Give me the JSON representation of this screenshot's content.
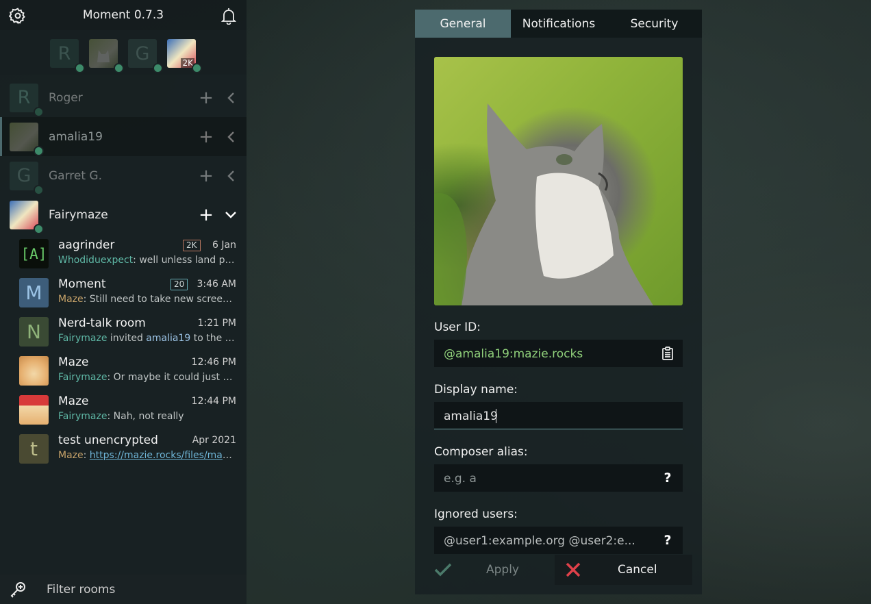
{
  "app": {
    "title": "Moment 0.7.3"
  },
  "colors": {
    "accent": "#4c6a6e",
    "presence": "#3d8b6a",
    "user_id": "#8fcf7a",
    "sender": "#5fb8a6",
    "cancel_x": "#e0414a"
  },
  "account_avatars": [
    {
      "letter": "R",
      "icon": "letter-avatar"
    },
    {
      "letter": "",
      "icon": "cat-avatar"
    },
    {
      "letter": "G",
      "icon": "letter-avatar"
    },
    {
      "letter": "",
      "icon": "anime-avatar",
      "badge": "2K"
    }
  ],
  "accounts": [
    {
      "name": "Roger",
      "letter": "R"
    },
    {
      "name": "amalia19",
      "letter": ""
    },
    {
      "name": "Garret G.",
      "letter": "G"
    },
    {
      "name": "Fairymaze",
      "letter": ""
    }
  ],
  "rooms": [
    {
      "name": "aagrinder",
      "avatar": "[A]",
      "badge": "2K",
      "time": "6 Jan",
      "sender": "Whodiduexpect",
      "preview": ": well unless land pr..."
    },
    {
      "name": "Moment",
      "avatar": "M",
      "badge": "20",
      "time": "3:46 AM",
      "sender": "Maze",
      "preview": ": Still need to take new screens..."
    },
    {
      "name": "Nerd-talk room",
      "avatar": "N",
      "badge": "",
      "time": "1:21 PM",
      "sender": "Fairymaze",
      "preview_mid": " invited ",
      "target": "amalia19",
      "preview": " to the ro..."
    },
    {
      "name": "Maze",
      "avatar": "",
      "badge": "",
      "time": "12:46 PM",
      "sender": "Fairymaze",
      "preview": ": Or maybe it could just be..."
    },
    {
      "name": "Maze",
      "avatar": "",
      "badge": "",
      "time": "12:44 PM",
      "sender": "Fairymaze",
      "preview": ": Nah, not really"
    },
    {
      "name": "test unencrypted",
      "avatar": "t",
      "badge": "",
      "time": "Apr 2021",
      "sender": "Maze",
      "link": "https://mazie.rocks/files/maz..."
    }
  ],
  "filter": {
    "placeholder": "Filter rooms"
  },
  "tabs": [
    "General",
    "Notifications",
    "Security"
  ],
  "form": {
    "user_id_label": "User ID:",
    "user_id_value": "@amalia19:mazie.rocks",
    "display_name_label": "Display name:",
    "display_name_value": "amalia19",
    "alias_label": "Composer alias:",
    "alias_placeholder": "e.g. a",
    "ignored_label": "Ignored users:",
    "ignored_placeholder": "@user1:example.org @user2:e...",
    "help_glyph": "?"
  },
  "buttons": {
    "apply": "Apply",
    "cancel": "Cancel"
  }
}
